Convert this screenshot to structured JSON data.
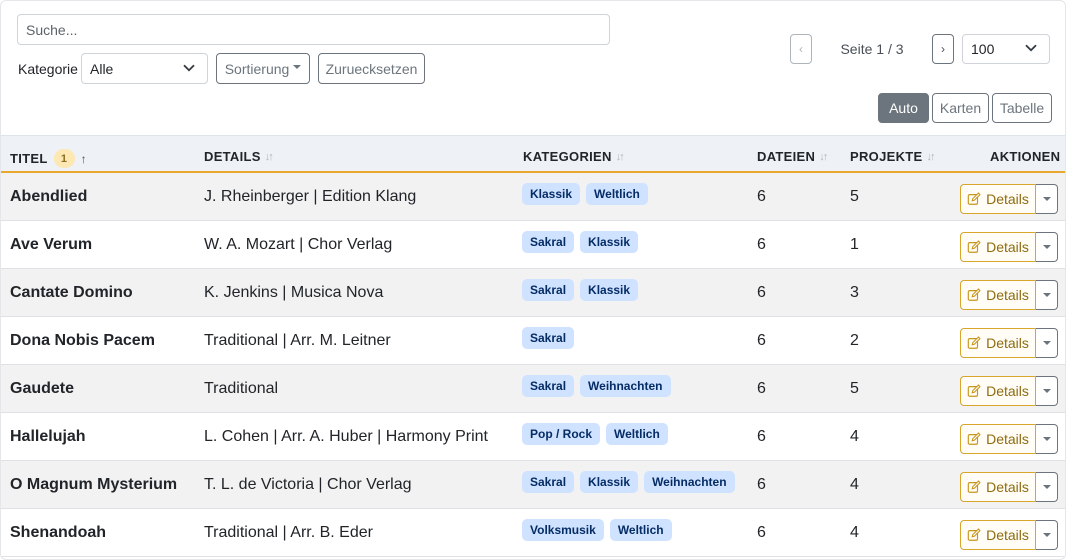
{
  "search": {
    "placeholder": "Suche..."
  },
  "filter": {
    "category_label": "Kategorie",
    "category_value": "Alle"
  },
  "sort_button": "Sortierung",
  "reset_button": "Zuruecksetzen",
  "pagination": {
    "prev": "‹",
    "info": "Seite 1 / 3",
    "next": "›",
    "page_size": "100"
  },
  "views": {
    "auto": "Auto",
    "cards": "Karten",
    "table": "Tabelle",
    "active": "Auto"
  },
  "columns": {
    "title": "TITEL",
    "title_sort_badge": "1",
    "title_sort_dir": "↑",
    "details": "DETAILS",
    "categories": "KATEGORIEN",
    "files": "DATEIEN",
    "projects": "PROJEKTE",
    "actions": "AKTIONEN",
    "sortable_icon": "sort-arrows-icon"
  },
  "rows": [
    {
      "title": "Abendlied",
      "details": "J. Rheinberger | Edition Klang",
      "categories": [
        "Klassik",
        "Weltlich"
      ],
      "files": "6",
      "projects": "5",
      "action": "Details"
    },
    {
      "title": "Ave Verum",
      "details": "W. A. Mozart | Chor Verlag",
      "categories": [
        "Sakral",
        "Klassik"
      ],
      "files": "6",
      "projects": "1",
      "action": "Details"
    },
    {
      "title": "Cantate Domino",
      "details": "K. Jenkins | Musica Nova",
      "categories": [
        "Sakral",
        "Klassik"
      ],
      "files": "6",
      "projects": "3",
      "action": "Details"
    },
    {
      "title": "Dona Nobis Pacem",
      "details": "Traditional | Arr. M. Leitner",
      "categories": [
        "Sakral"
      ],
      "files": "6",
      "projects": "2",
      "action": "Details"
    },
    {
      "title": "Gaudete",
      "details": "Traditional",
      "categories": [
        "Sakral",
        "Weihnachten"
      ],
      "files": "6",
      "projects": "5",
      "action": "Details"
    },
    {
      "title": "Hallelujah",
      "details": "L. Cohen | Arr. A. Huber | Harmony Print",
      "categories": [
        "Pop / Rock",
        "Weltlich"
      ],
      "files": "6",
      "projects": "4",
      "action": "Details"
    },
    {
      "title": "O Magnum Mysterium",
      "details": "T. L. de Victoria | Chor Verlag",
      "categories": [
        "Sakral",
        "Klassik",
        "Weihnachten"
      ],
      "files": "6",
      "projects": "4",
      "action": "Details"
    },
    {
      "title": "Shenandoah",
      "details": "Traditional | Arr. B. Eder",
      "categories": [
        "Volksmusik",
        "Weltlich"
      ],
      "files": "6",
      "projects": "4",
      "action": "Details"
    }
  ],
  "colors": {
    "accent": "#e8a82e",
    "tag_bg": "#cfe2ff",
    "tag_text": "#052c65",
    "active_view": "#6c757d",
    "details_btn": "#d9a52a"
  }
}
